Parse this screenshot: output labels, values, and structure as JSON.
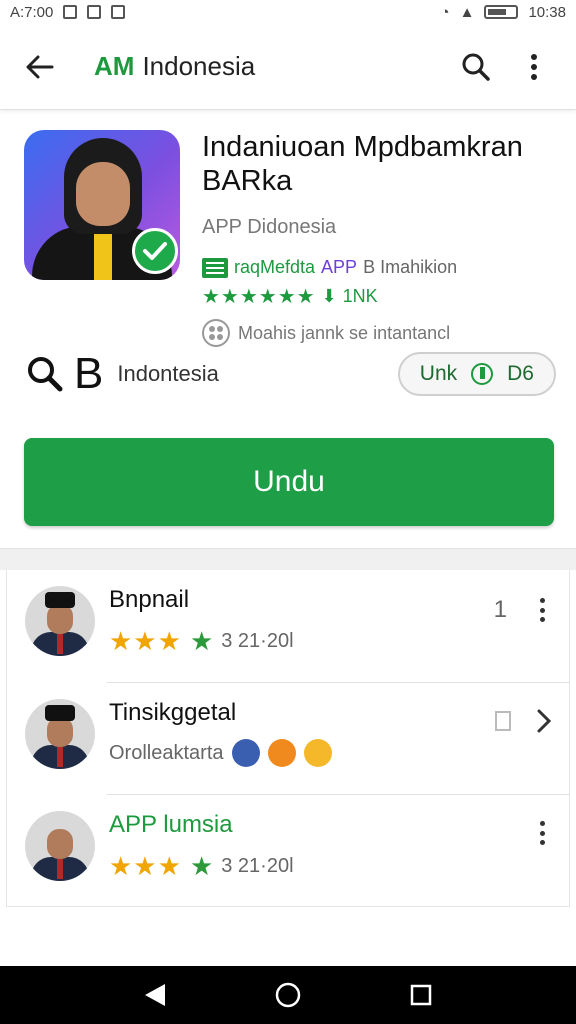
{
  "status_bar": {
    "left_text": "A:7:00",
    "right_text": "10:38"
  },
  "app_bar": {
    "brand": "AM",
    "title": "Indonesia"
  },
  "app": {
    "name": "Indaniuoan Mpdbamkran BARka",
    "developer": "APP Didonesia",
    "category_green": "raqMefdta",
    "category_purple": "APP",
    "category_rest": "B Imahikion",
    "rating_text": "1NK",
    "ads_text": "Moahis jannk se intantancl"
  },
  "meta": {
    "letters": "Q B",
    "label": "Indontesia",
    "pill_text": "Unk",
    "pill_value": "D6"
  },
  "install_label": "Undu",
  "reviews": [
    {
      "name": "Bnpnail",
      "date": "3 21·20l",
      "count": "1"
    },
    {
      "name": "Tinsikggetal",
      "sub": "Orolleaktarta"
    },
    {
      "name": "APP lumsia",
      "date": "3 21·20l"
    }
  ],
  "colors": {
    "brand_green": "#1e9e46",
    "purple": "#6c3fd6",
    "star_gold": "#f0a500"
  }
}
